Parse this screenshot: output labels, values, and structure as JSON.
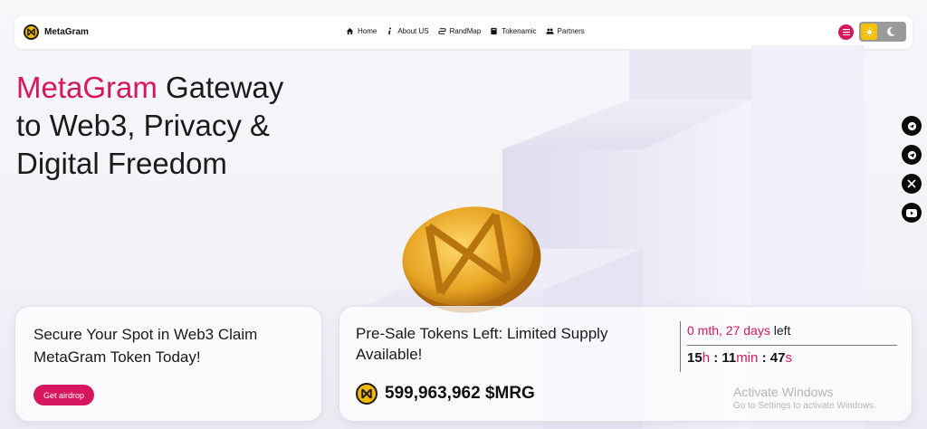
{
  "brand": {
    "name": "MetaGram",
    "logo_icon": "metagram-logo-icon",
    "logo_color": "#f2b705"
  },
  "nav": {
    "items": [
      {
        "label": "Home",
        "icon": "home-icon"
      },
      {
        "label": "About US",
        "icon": "info-icon"
      },
      {
        "label": "RandMap",
        "icon": "route-icon"
      },
      {
        "label": "Tokenamic",
        "icon": "book-icon"
      },
      {
        "label": "Partners",
        "icon": "users-icon"
      }
    ],
    "menu_icon": "hamburger-icon",
    "theme_toggle": {
      "light_icon": "sun-icon",
      "dark_icon": "moon-icon",
      "active": "light"
    }
  },
  "hero": {
    "title_accent": "MetaGram",
    "title_rest_1": " Gateway",
    "title_line_2": "to Web3, Privacy &",
    "title_line_3": "Digital Freedom"
  },
  "social": [
    "social-icon-1",
    "telegram-icon",
    "x-icon",
    "youtube-icon"
  ],
  "airdrop_card": {
    "line1": "Secure Your Spot in Web3 Claim",
    "line2": "MetaGram Token Today!",
    "button_label": "Get airdrop"
  },
  "presale_card": {
    "line1": "Pre-Sale Tokens Left: Limited Supply",
    "line2": "Available!",
    "amount": "599,963,962 $MRG",
    "countdown": {
      "top_value": "0 mth, 27 days",
      "top_suffix": " left",
      "hours": "15",
      "hours_unit": "h",
      "minutes": "11",
      "minutes_unit": "min",
      "seconds": "47",
      "seconds_unit": "s"
    }
  },
  "watermark": {
    "title": "Activate Windows",
    "subtitle": "Go to Settings to activate Windows."
  },
  "colors": {
    "accent": "#d6165f",
    "gold": "#f2b705",
    "dark": "#0b0b0b"
  }
}
